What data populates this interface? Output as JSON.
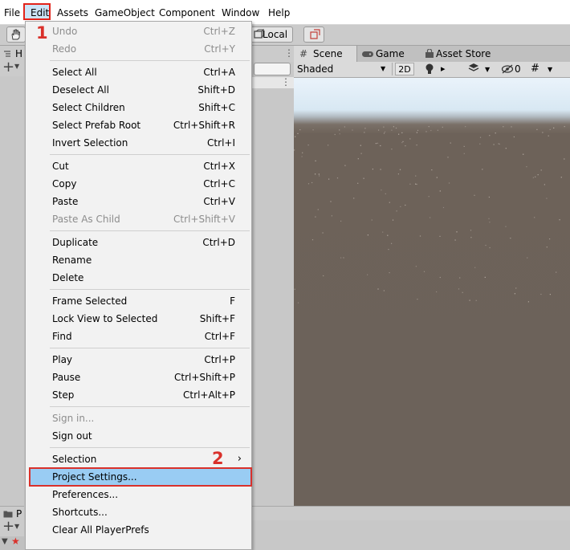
{
  "menubar": {
    "items": [
      "File",
      "Edit",
      "Assets",
      "GameObject",
      "Component",
      "Window",
      "Help"
    ]
  },
  "toolbar": {
    "local_label": "Local"
  },
  "hierarchy": {
    "tab_letter": "H"
  },
  "project": {
    "tab_letter": "P"
  },
  "scene_view": {
    "tabs": [
      "Scene",
      "Game",
      "Asset Store"
    ],
    "shading_mode": "Shaded",
    "mode_2d": "2D",
    "hidden_count": "0"
  },
  "edit_menu": {
    "groups": [
      [
        {
          "label": "Undo",
          "shortcut": "Ctrl+Z",
          "enabled": false
        },
        {
          "label": "Redo",
          "shortcut": "Ctrl+Y",
          "enabled": false
        }
      ],
      [
        {
          "label": "Select All",
          "shortcut": "Ctrl+A",
          "enabled": true
        },
        {
          "label": "Deselect All",
          "shortcut": "Shift+D",
          "enabled": true
        },
        {
          "label": "Select Children",
          "shortcut": "Shift+C",
          "enabled": true
        },
        {
          "label": "Select Prefab Root",
          "shortcut": "Ctrl+Shift+R",
          "enabled": true
        },
        {
          "label": "Invert Selection",
          "shortcut": "Ctrl+I",
          "enabled": true
        }
      ],
      [
        {
          "label": "Cut",
          "shortcut": "Ctrl+X",
          "enabled": true
        },
        {
          "label": "Copy",
          "shortcut": "Ctrl+C",
          "enabled": true
        },
        {
          "label": "Paste",
          "shortcut": "Ctrl+V",
          "enabled": true
        },
        {
          "label": "Paste As Child",
          "shortcut": "Ctrl+Shift+V",
          "enabled": false
        }
      ],
      [
        {
          "label": "Duplicate",
          "shortcut": "Ctrl+D",
          "enabled": true
        },
        {
          "label": "Rename",
          "shortcut": "",
          "enabled": true
        },
        {
          "label": "Delete",
          "shortcut": "",
          "enabled": true
        }
      ],
      [
        {
          "label": "Frame Selected",
          "shortcut": "F",
          "enabled": true
        },
        {
          "label": "Lock View to Selected",
          "shortcut": "Shift+F",
          "enabled": true
        },
        {
          "label": "Find",
          "shortcut": "Ctrl+F",
          "enabled": true
        }
      ],
      [
        {
          "label": "Play",
          "shortcut": "Ctrl+P",
          "enabled": true
        },
        {
          "label": "Pause",
          "shortcut": "Ctrl+Shift+P",
          "enabled": true
        },
        {
          "label": "Step",
          "shortcut": "Ctrl+Alt+P",
          "enabled": true
        }
      ],
      [
        {
          "label": "Sign in...",
          "shortcut": "",
          "enabled": false
        },
        {
          "label": "Sign out",
          "shortcut": "",
          "enabled": true
        }
      ],
      [
        {
          "label": "Selection",
          "shortcut": "",
          "enabled": true,
          "submenu": true
        },
        {
          "label": "Project Settings...",
          "shortcut": "",
          "enabled": true,
          "highlighted": true
        },
        {
          "label": "Preferences...",
          "shortcut": "",
          "enabled": true
        },
        {
          "label": "Shortcuts...",
          "shortcut": "",
          "enabled": true
        },
        {
          "label": "Clear All PlayerPrefs",
          "shortcut": "",
          "enabled": true
        }
      ]
    ]
  },
  "annotations": {
    "step1": "1",
    "step2": "2"
  },
  "colors": {
    "highlight": "#99ccf3",
    "annotation_red": "#d9312b",
    "ground": "#6c625a"
  }
}
